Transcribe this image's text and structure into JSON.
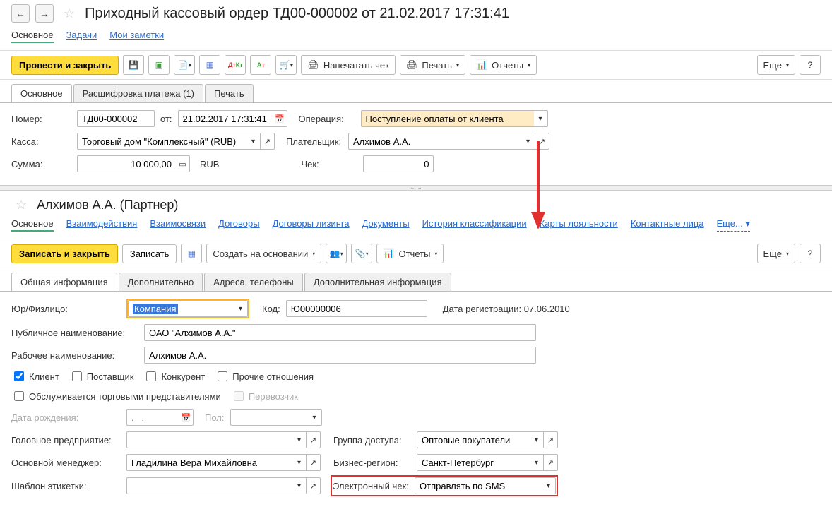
{
  "header": {
    "title": "Приходный кассовый ордер ТД00-000002 от 21.02.2017 17:31:41"
  },
  "nav_links_top": {
    "main": "Основное",
    "tasks": "Задачи",
    "notes": "Мои заметки"
  },
  "toolbar1": {
    "post_close": "Провести и закрыть",
    "print_receipt": "Напечатать чек",
    "print": "Печать",
    "reports": "Отчеты",
    "more": "Еще",
    "help": "?"
  },
  "doc_tabs": {
    "main": "Основное",
    "payment_details": "Расшифровка платежа (1)",
    "print": "Печать"
  },
  "doc_form": {
    "number_label": "Номер:",
    "number": "ТД00-000002",
    "from_label": "от:",
    "date": "21.02.2017 17:31:41",
    "operation_label": "Операция:",
    "operation": "Поступление оплаты от клиента",
    "cashdesk_label": "Касса:",
    "cashdesk": "Торговый дом \"Комплексный\" (RUB)",
    "payer_label": "Плательщик:",
    "payer": "Алхимов А.А.",
    "sum_label": "Сумма:",
    "sum": "10 000,00",
    "currency": "RUB",
    "check_label": "Чек:",
    "check": "0"
  },
  "partner": {
    "title": "Алхимов А.А. (Партнер)"
  },
  "nav_links_partner": {
    "main": "Основное",
    "interactions": "Взаимодействия",
    "relations": "Взаимосвязи",
    "contracts": "Договоры",
    "leasing": "Договоры лизинга",
    "documents": "Документы",
    "class_history": "История классификации",
    "loyalty": "Карты лояльности",
    "contacts": "Контактные лица",
    "more": "Еще..."
  },
  "toolbar2": {
    "save_close": "Записать и закрыть",
    "save": "Записать",
    "create_from": "Создать на основании",
    "reports": "Отчеты",
    "more": "Еще",
    "help": "?"
  },
  "partner_tabs": {
    "general": "Общая информация",
    "additional": "Дополнительно",
    "addresses": "Адреса, телефоны",
    "extra_info": "Дополнительная информация"
  },
  "partner_form": {
    "entity_label": "Юр/Физлицо:",
    "entity": "Компания",
    "code_label": "Код:",
    "code": "Ю00000006",
    "reg_date_label": "Дата регистрации:",
    "reg_date": "07.06.2010",
    "public_name_label": "Публичное наименование:",
    "public_name": "ОАО \"Алхимов А.А.\"",
    "work_name_label": "Рабочее наименование:",
    "work_name": "Алхимов А.А.",
    "client": "Клиент",
    "supplier": "Поставщик",
    "competitor": "Конкурент",
    "other_rel": "Прочие отношения",
    "sales_reps": "Обслуживается торговыми представителями",
    "carrier": "Перевозчик",
    "birth_label": "Дата рождения:",
    "birth_placeholder": ".   .",
    "gender_label": "Пол:",
    "head_company_label": "Головное предприятие:",
    "access_group_label": "Группа доступа:",
    "access_group": "Оптовые покупатели",
    "main_manager_label": "Основной менеджер:",
    "main_manager": "Гладилина Вера Михайловна",
    "business_region_label": "Бизнес-регион:",
    "business_region": "Санкт-Петербург",
    "label_template_label": "Шаблон этикетки:",
    "echeck_label": "Электронный чек:",
    "echeck": "Отправлять по SMS"
  }
}
